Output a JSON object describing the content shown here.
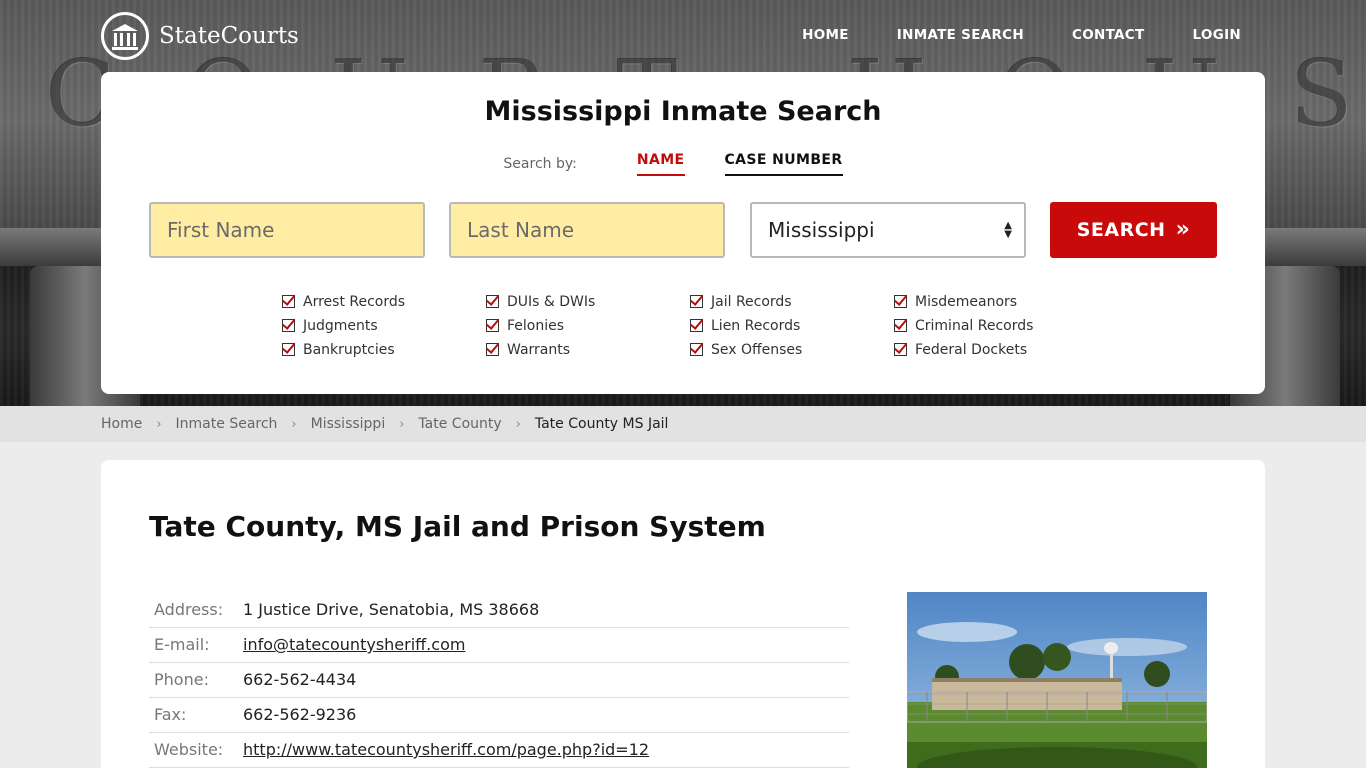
{
  "brand": {
    "name": "StateCourts"
  },
  "nav": [
    "HOME",
    "INMATE SEARCH",
    "CONTACT",
    "LOGIN"
  ],
  "hero": {
    "carving": "COURT HOUSE"
  },
  "search": {
    "title": "Mississippi Inmate Search",
    "search_by_label": "Search by:",
    "tab_name": "NAME",
    "tab_case": "CASE NUMBER",
    "first_placeholder": "First Name",
    "last_placeholder": "Last Name",
    "state_value": "Mississippi",
    "button_label": "SEARCH",
    "categories": [
      "Arrest Records",
      "DUIs & DWIs",
      "Jail Records",
      "Misdemeanors",
      "Judgments",
      "Felonies",
      "Lien Records",
      "Criminal Records",
      "Bankruptcies",
      "Warrants",
      "Sex Offenses",
      "Federal Dockets"
    ]
  },
  "breadcrumb": [
    "Home",
    "Inmate Search",
    "Mississippi",
    "Tate County",
    "Tate County MS Jail"
  ],
  "facility": {
    "title": "Tate County, MS Jail and Prison System",
    "rows": [
      {
        "label": "Address:",
        "value": "1 Justice Drive, Senatobia, MS 38668"
      },
      {
        "label": "E-mail:",
        "value": "info@tatecountysheriff.com"
      },
      {
        "label": "Phone:",
        "value": "662-562-4434"
      },
      {
        "label": "Fax:",
        "value": "662-562-9236"
      },
      {
        "label": "Website:",
        "value": "http://www.tatecountysheriff.com/page.php?id=12"
      }
    ]
  },
  "colors": {
    "accent": "#c90a0a",
    "input_bg": "#feeda3"
  }
}
